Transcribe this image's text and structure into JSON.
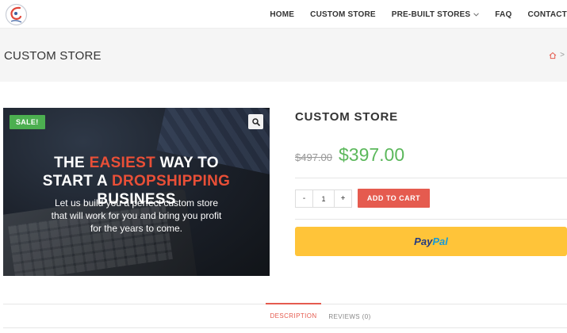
{
  "header": {
    "nav": [
      {
        "label": "HOME"
      },
      {
        "label": "CUSTOM STORE"
      },
      {
        "label": "PRE-BUILT STORES"
      },
      {
        "label": "FAQ"
      },
      {
        "label": "CONTACT"
      }
    ],
    "dropdown_icon": "chevron-down-icon"
  },
  "titlebar": {
    "title": "CUSTOM STORE",
    "breadcrumb_separator": ">"
  },
  "product_image": {
    "badge": "SALE!",
    "headline_line1_part1": "THE ",
    "headline_line1_highlight": "EASIEST",
    "headline_line1_part2": " WAY TO",
    "headline_line2_part1": "START A ",
    "headline_line2_highlight": "DROPSHIPPING",
    "headline_line2_part2": " BUSINESS",
    "sub_line1": "Let us build you a perfect custom store",
    "sub_line2": "that will work for you and bring you profit",
    "sub_line3": "for the years to come."
  },
  "product": {
    "title": "CUSTOM STORE",
    "old_price": "$497.00",
    "new_price": "$397.00",
    "qty_minus": "-",
    "qty_value": "1",
    "qty_plus": "+",
    "add_to_cart": "ADD TO CART",
    "paypal_part1": "Pay",
    "paypal_part2": "Pal"
  },
  "tabs": {
    "description": "DESCRIPTION",
    "reviews": "REVIEWS (0)"
  },
  "colors": {
    "accent": "#e55b4f",
    "price_green": "#5cb85c",
    "sale_badge": "#4caf50",
    "paypal_yellow": "#ffc439"
  }
}
